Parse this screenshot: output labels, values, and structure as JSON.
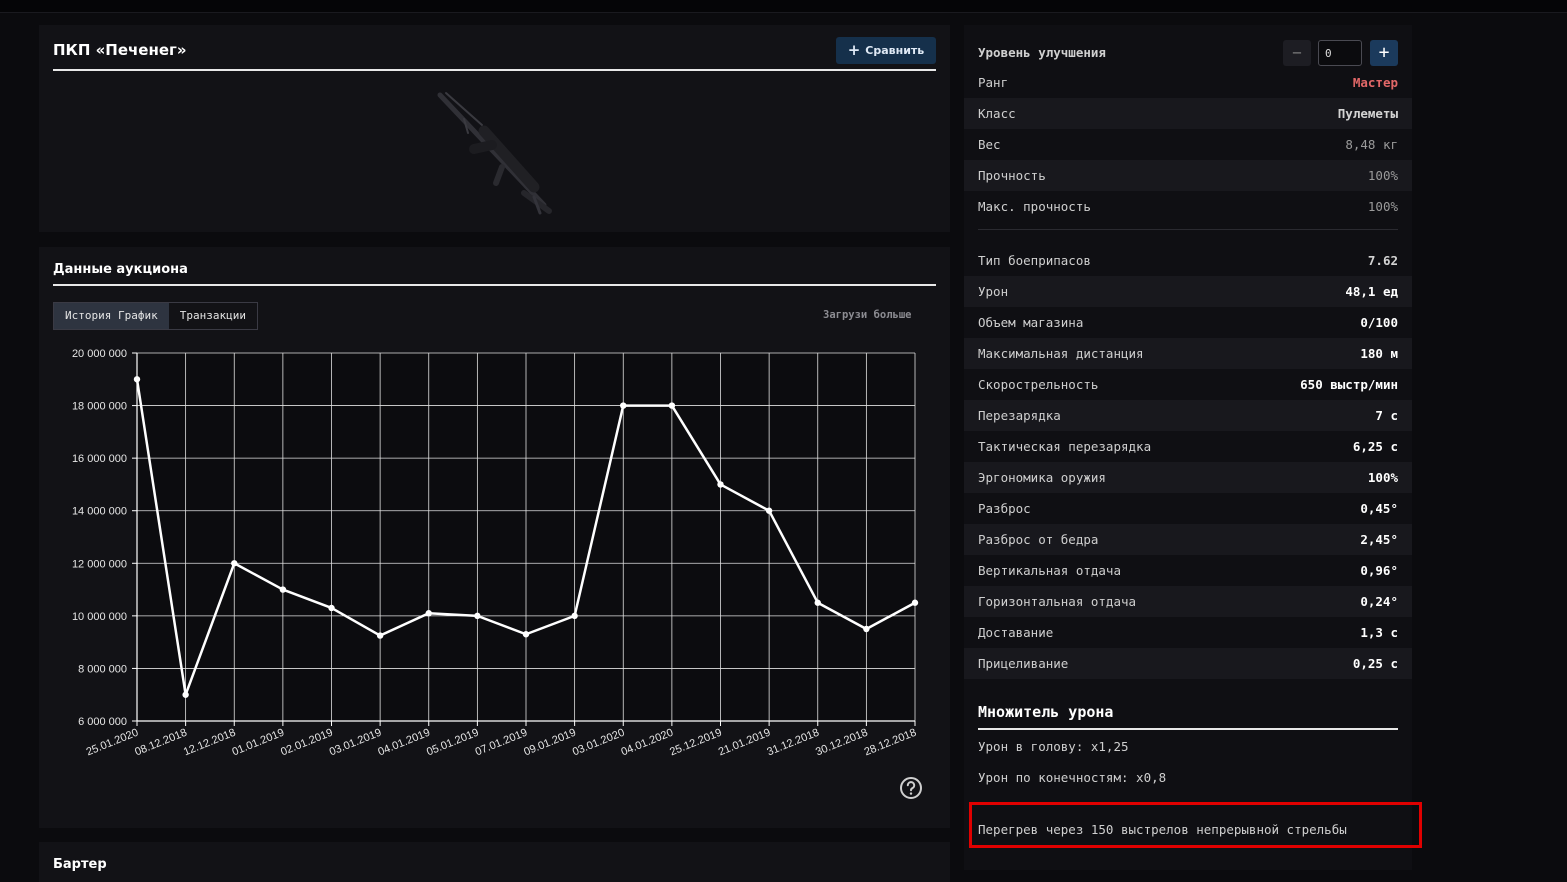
{
  "item": {
    "title": "ПКП «Печенег»",
    "compare_label": "Сравнить",
    "image_icon": "machine-gun-icon"
  },
  "auction": {
    "title": "Данные аукциона",
    "tabs": [
      {
        "label": "История График",
        "active": true
      },
      {
        "label": "Транзакции",
        "active": false
      }
    ],
    "load_more": "Загрузи больше",
    "help_icon": "question-circle-icon"
  },
  "chart_data": {
    "type": "line",
    "categories": [
      "25.01.2020",
      "08.12.2018",
      "12.12.2018",
      "01.01.2019",
      "02.01.2019",
      "03.01.2019",
      "04.01.2019",
      "05.01.2019",
      "07.01.2019",
      "09.01.2019",
      "03.01.2020",
      "04.01.2020",
      "25.12.2019",
      "21.01.2019",
      "31.12.2018",
      "30.12.2018",
      "28.12.2018"
    ],
    "values": [
      19000000,
      7000000,
      12000000,
      11000000,
      10300000,
      9250000,
      10100000,
      10000000,
      9300000,
      10000000,
      18000000,
      18000000,
      15000000,
      14000000,
      10500000,
      9500000,
      10500000
    ],
    "y_ticks": [
      "6 000 000",
      "8 000 000",
      "10 000 000",
      "12 000 000",
      "14 000 000",
      "16 000 000",
      "18 000 000",
      "20 000 000"
    ],
    "ylim": [
      6000000,
      20000000
    ],
    "grid": true,
    "line_color": "#ffffff"
  },
  "barter": {
    "title": "Бартер"
  },
  "stats": {
    "upgrade_label": "Уровень улучшения",
    "upgrade_value": "0",
    "rows_top": [
      {
        "label": "Ранг",
        "value": "Мастер",
        "style": "red"
      },
      {
        "label": "Класс",
        "value": "Пулеметы",
        "style": "semi"
      },
      {
        "label": "Вес",
        "value": "8,48 кг",
        "style": "grey"
      },
      {
        "label": "Прочность",
        "value": "100%",
        "style": "grey"
      },
      {
        "label": "Макс. прочность",
        "value": "100%",
        "style": "grey"
      }
    ],
    "rows_main": [
      {
        "label": "Тип боеприпасов",
        "value": "7.62",
        "style": "semi"
      },
      {
        "label": "Урон",
        "value": "48,1 ед",
        "style": ""
      },
      {
        "label": "Объем магазина",
        "value": "0/100",
        "style": ""
      },
      {
        "label": "Максимальная дистанция",
        "value": "180 м",
        "style": ""
      },
      {
        "label": "Скорострельность",
        "value": "650 выстр/мин",
        "style": ""
      },
      {
        "label": "Перезарядка",
        "value": "7 с",
        "style": ""
      },
      {
        "label": "Тактическая перезарядка",
        "value": "6,25 с",
        "style": ""
      },
      {
        "label": "Эргономика оружия",
        "value": "100%",
        "style": ""
      },
      {
        "label": "Разброс",
        "value": "0,45°",
        "style": ""
      },
      {
        "label": "Разброс от бедра",
        "value": "2,45°",
        "style": ""
      },
      {
        "label": "Вертикальная отдача",
        "value": "0,96°",
        "style": ""
      },
      {
        "label": "Горизонтальная отдача",
        "value": "0,24°",
        "style": ""
      },
      {
        "label": "Доставание",
        "value": "1,3 с",
        "style": ""
      },
      {
        "label": "Прицеливание",
        "value": "0,25 с",
        "style": ""
      }
    ],
    "multiplier_title": "Множитель урона",
    "head_damage": "Урон в голову: x1,25",
    "limb_damage": "Урон по конечностям: x0,8",
    "overheat": "Перегрев через 150 выстрелов непрерывной стрельбы"
  }
}
